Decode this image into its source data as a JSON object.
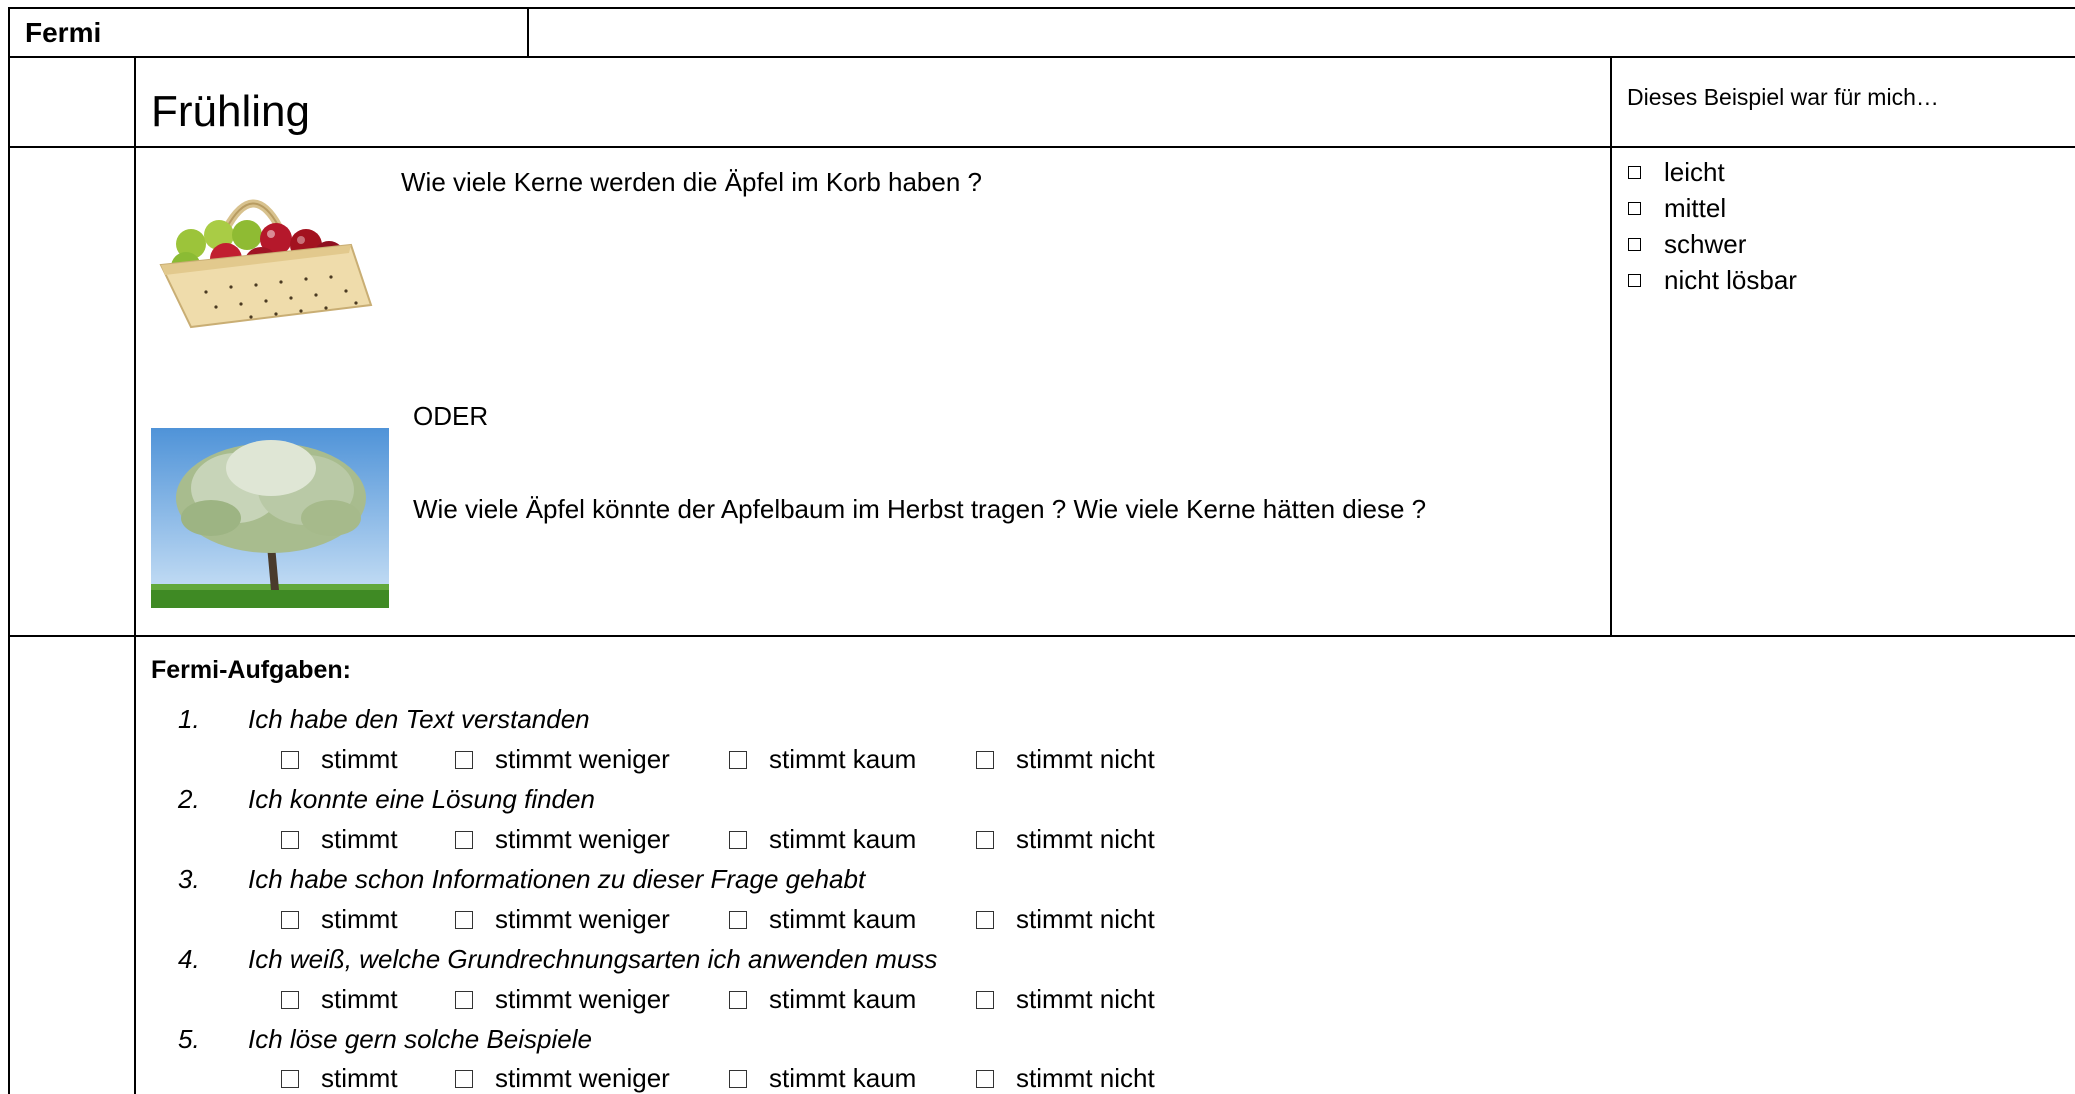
{
  "header": {
    "title": "Fermi"
  },
  "task": {
    "title": "Frühling",
    "question1": "Wie viele Kerne werden die Äpfel im Korb haben ?",
    "or_label": "ODER",
    "question2": "Wie viele Äpfel könnte der Apfelbaum im Herbst tragen ? Wie viele Kerne hätten diese ?",
    "images": [
      "apple-basket-photo",
      "apple-tree-photo"
    ]
  },
  "rating": {
    "heading": "Dieses Beispiel war für mich…",
    "options": [
      "leicht",
      "mittel",
      "schwer",
      "nicht lösbar"
    ]
  },
  "survey": {
    "title": "Fermi-Aufgaben:",
    "options": [
      "stimmt",
      "stimmt weniger",
      "stimmt kaum",
      "stimmt nicht"
    ],
    "statements": [
      {
        "num": "1.",
        "text": "Ich habe den Text verstanden"
      },
      {
        "num": "2.",
        "text": "Ich konnte eine Lösung finden"
      },
      {
        "num": "3.",
        "text": "Ich habe schon Informationen zu dieser Frage gehabt"
      },
      {
        "num": "4.",
        "text": "Ich weiß, welche Grundrechnungsarten ich anwenden muss"
      },
      {
        "num": "5.",
        "text": "Ich löse gern solche Beispiele"
      }
    ]
  }
}
